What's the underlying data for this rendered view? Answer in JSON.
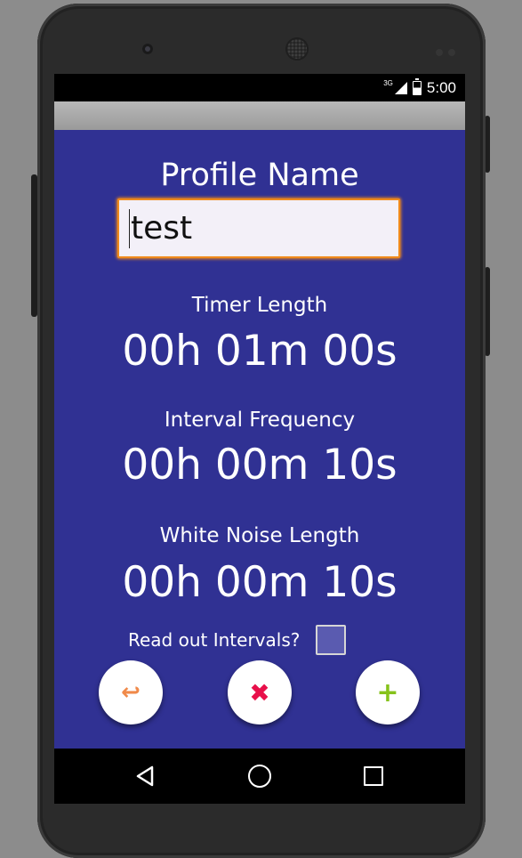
{
  "status_bar": {
    "network": "3G",
    "time": "5:00",
    "icons": [
      "signal-icon",
      "battery-icon"
    ]
  },
  "form": {
    "profile_name_label": "Profile Name",
    "profile_name_value": "test",
    "timer_length_label": "Timer Length",
    "timer_length_value": "00h 01m 00s",
    "interval_frequency_label": "Interval Frequency",
    "interval_frequency_value": "00h 00m 10s",
    "white_noise_length_label": "White Noise Length",
    "white_noise_length_value": "00h 00m 10s",
    "read_out_label": "Read out Intervals?",
    "read_out_checked": false
  },
  "actions": {
    "undo_icon": "↩",
    "cancel_icon": "✖",
    "add_icon": "+"
  },
  "nav_bar": {
    "icons": [
      "back-icon",
      "home-icon",
      "recent-apps-icon"
    ]
  },
  "colors": {
    "background": "#303193",
    "input_border": "#f08a1c",
    "undo": "#f08a4a",
    "cancel": "#e8104a",
    "add": "#86c21b"
  }
}
